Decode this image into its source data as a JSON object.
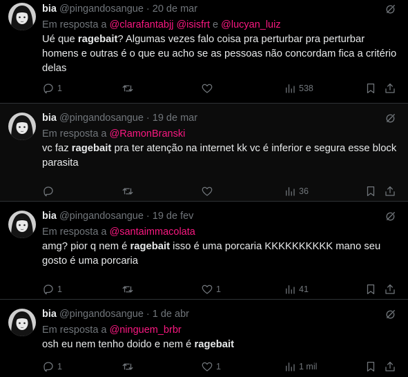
{
  "tweets": [
    {
      "name": "bia",
      "handle": "@pingandosangue",
      "date": "20 de mar",
      "reply_prefix": "Em resposta a",
      "mentions": [
        "@clarafantabjj",
        "@isisfrt",
        "@lucyan_luiz"
      ],
      "mention_joiner": "e",
      "text_parts": [
        {
          "t": "Ué que ",
          "b": false
        },
        {
          "t": "ragebait",
          "b": true
        },
        {
          "t": "? Algumas vezes falo coisa pra perturbar pra perturbar homens e outras é o que eu acho se as pessoas não concordam fica a critério delas",
          "b": false
        }
      ],
      "replies": "1",
      "retweets": "",
      "likes": "",
      "views": "538"
    },
    {
      "name": "bia",
      "handle": "@pingandosangue",
      "date": "19 de mar",
      "reply_prefix": "Em resposta a",
      "mentions": [
        "@RamonBranski"
      ],
      "text_parts": [
        {
          "t": "vc faz ",
          "b": false
        },
        {
          "t": "ragebait",
          "b": true
        },
        {
          "t": " pra ter atenção na internet kk vc é inferior e segura esse block parasita",
          "b": false
        }
      ],
      "replies": "",
      "retweets": "",
      "likes": "",
      "views": "36"
    },
    {
      "name": "bia",
      "handle": "@pingandosangue",
      "date": "19 de fev",
      "reply_prefix": "Em resposta a",
      "mentions": [
        "@santaimmacolata"
      ],
      "text_parts": [
        {
          "t": "amg? pior q nem é ",
          "b": false
        },
        {
          "t": "ragebait",
          "b": true
        },
        {
          "t": " isso é uma porcaria KKKKKKKKKK mano seu gosto é uma porcaria",
          "b": false
        }
      ],
      "replies": "1",
      "retweets": "",
      "likes": "1",
      "views": "41"
    },
    {
      "name": "bia",
      "handle": "@pingandosangue",
      "date": "1 de abr",
      "reply_prefix": "Em resposta a",
      "mentions": [
        "@ninguem_brbr"
      ],
      "text_parts": [
        {
          "t": "osh eu nem tenho doido e nem é ",
          "b": false
        },
        {
          "t": "ragebait",
          "b": true
        }
      ],
      "replies": "1",
      "retweets": "",
      "likes": "1",
      "views": "1 mil"
    }
  ],
  "colors": {
    "background": "#000000",
    "text": "#e7e9ea",
    "muted": "#71767b",
    "mention": "#f91880",
    "divider": "#2f3336"
  },
  "icons": [
    "reply-icon",
    "retweet-icon",
    "like-icon",
    "views-icon",
    "bookmark-icon",
    "share-icon",
    "grok-icon",
    "avatar"
  ]
}
